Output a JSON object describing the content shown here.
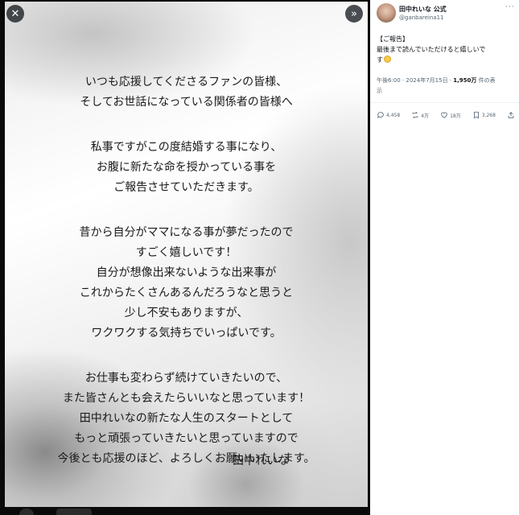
{
  "viewer": {
    "close_glyph": "✕",
    "expand_glyph": "»",
    "letter": {
      "paragraphs": [
        [
          "いつも応援してくださるファンの皆様、",
          "そしてお世話になっている関係者の皆様へ"
        ],
        [
          "私事ですがこの度結婚する事になり、",
          "お腹に新たな命を授かっている事を",
          "ご報告させていただきます。"
        ],
        [
          "昔から自分がママになる事が夢だったので",
          "すごく嬉しいです！",
          "自分が想像出来ないような出来事が",
          "これからたくさんあるんだろうなと思うと",
          "少し不安もありますが、",
          "ワクワクする気持ちでいっぱいです。"
        ],
        [
          "お仕事も変わらず続けていきたいので、",
          "また皆さんとも会えたらいいなと思っています！",
          "田中れいなの新たな人生のスタートとして",
          "もっと頑張っていきたいと思っていますので",
          "今後とも応援のほど、よろしくお願いいたします。"
        ]
      ],
      "signature": "田中れいな"
    }
  },
  "post": {
    "author_name": "田中れいな 公式",
    "author_handle": "@ganbareina11",
    "more_glyph": "···",
    "text_lines": [
      "【ご報告】",
      "最後まで読んでいただけると嬉しいで",
      "す"
    ],
    "meta_line1": "午後6:00 · 2024年7月15日 · ",
    "views_count": "1,950万",
    "views_label": " 件の表",
    "meta_line2": "示",
    "actions": {
      "replies": "4,458",
      "reposts": "4万",
      "likes": "18万",
      "bookmarks": "3,268"
    }
  },
  "colors": {
    "accent": "#1d9bf0",
    "secondary_text": "#536471",
    "viewer_background": "#0a0a0a"
  }
}
